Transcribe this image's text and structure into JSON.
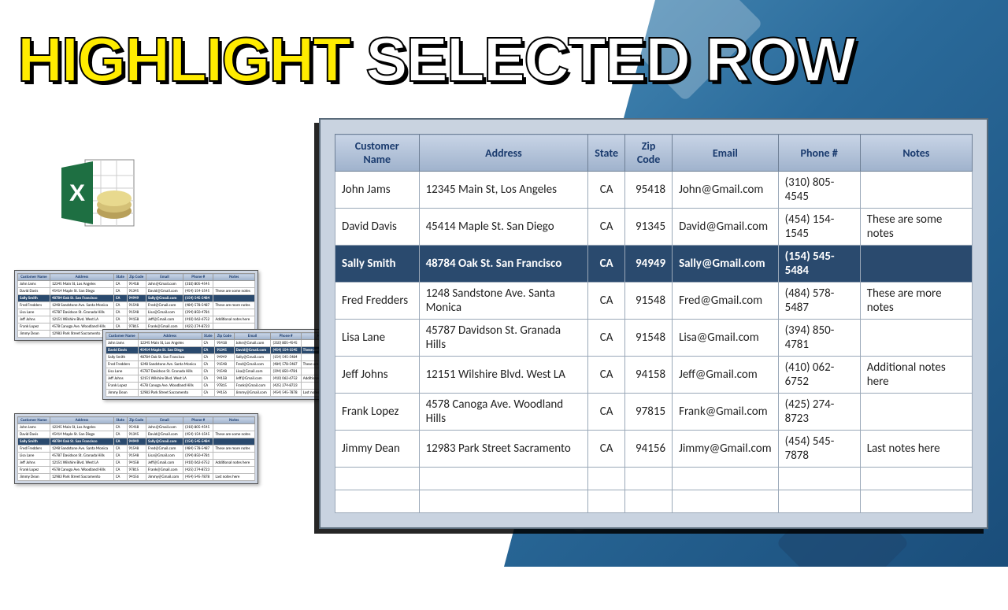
{
  "headline": {
    "part1": "HIGHLIGHT",
    "part2": " SELECTED ROW"
  },
  "icon_name": "excel-icon",
  "table": {
    "headers": [
      "Customer Name",
      "Address",
      "State",
      "Zip Code",
      "Email",
      "Phone #",
      "Notes"
    ],
    "rows": [
      {
        "name": "John Jams",
        "address": "12345 Main St, Los Angeles",
        "state": "CA",
        "zip": "95418",
        "email": "John@Gmail.com",
        "phone": "(310) 805-4545",
        "notes": ""
      },
      {
        "name": "David Davis",
        "address": "45414 Maple St. San Diego",
        "state": "CA",
        "zip": "91345",
        "email": "David@Gmail.com",
        "phone": "(454) 154-1545",
        "notes": "These are some notes"
      },
      {
        "name": "Sally Smith",
        "address": "48784 Oak St. San Francisco",
        "state": "CA",
        "zip": "94949",
        "email": "Sally@Gmail.com",
        "phone": "(154) 545-5484",
        "notes": "",
        "selected": true
      },
      {
        "name": "Fred Fredders",
        "address": "1248 Sandstone Ave. Santa Monica",
        "state": "CA",
        "zip": "91548",
        "email": "Fred@Gmail.com",
        "phone": "(484) 578-5487",
        "notes": "These are more notes"
      },
      {
        "name": "Lisa Lane",
        "address": "45787 Davidson St. Granada Hills",
        "state": "CA",
        "zip": "91548",
        "email": "Lisa@Gmail.com",
        "phone": "(394) 850-4781",
        "notes": ""
      },
      {
        "name": "Jeff Johns",
        "address": "12151 Wilshire Blvd. West LA",
        "state": "CA",
        "zip": "94158",
        "email": "Jeff@Gmail.com",
        "phone": "(410) 062-6752",
        "notes": "Additional notes here"
      },
      {
        "name": "Frank Lopez",
        "address": "4578 Canoga  Ave. Woodland Hills",
        "state": "CA",
        "zip": "97815",
        "email": "Frank@Gmail.com",
        "phone": "(425) 274-8723",
        "notes": ""
      },
      {
        "name": "Jimmy Dean",
        "address": "12983 Park Street Sacramento",
        "state": "CA",
        "zip": "94156",
        "email": "Jimmy@Gmail.com",
        "phone": "(454) 545-7878",
        "notes": "Last notes here"
      }
    ],
    "empty_rows": 2
  },
  "mini_selected": {
    "m1": 2,
    "m2": 1,
    "m3": 2
  }
}
